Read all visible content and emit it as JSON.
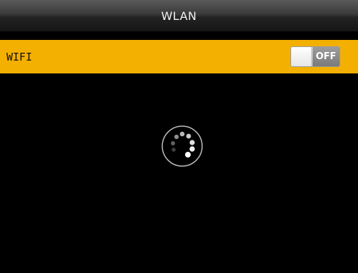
{
  "header": {
    "title": "WLAN"
  },
  "wifi": {
    "label": "WIFI",
    "toggle_label": "OFF",
    "enabled": false
  },
  "loading": {
    "icon": "loading-spinner-icon"
  },
  "colors": {
    "accent": "#f4b000",
    "background": "#000000"
  }
}
